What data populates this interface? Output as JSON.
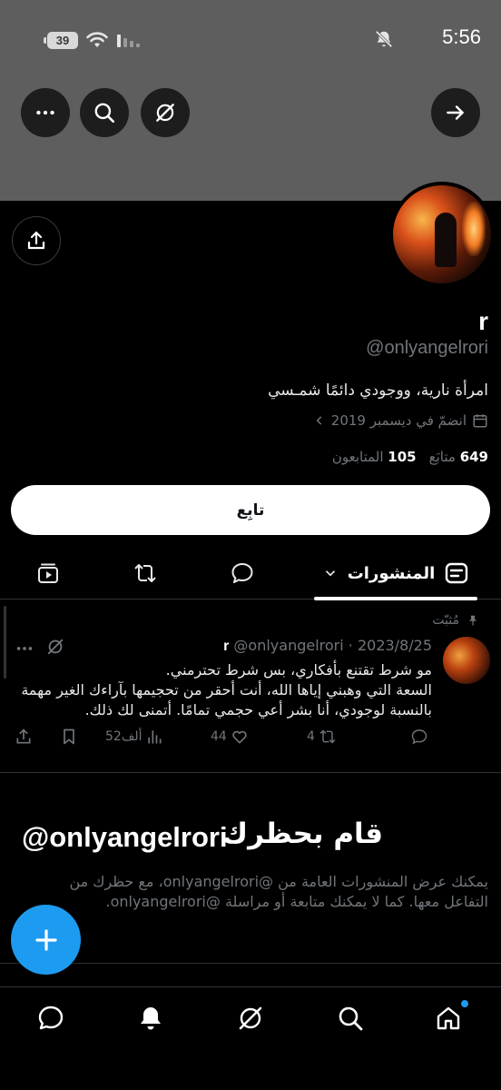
{
  "status_bar": {
    "time": "5:56",
    "battery": "39"
  },
  "header": {
    "more_icon": "more-horizontal-icon",
    "search_icon": "search-icon",
    "grok_icon": "grok-icon",
    "forward_icon": "arrow-forward-icon"
  },
  "profile": {
    "display_name": "r",
    "handle": "@onlyangelrori",
    "bio": "امرأة نارية، ووجودي دائمًا شمـسي",
    "joined": "انضمّ في ديسمبر 2019",
    "following_count": "649",
    "following_label": "متابَع",
    "followers_count": "105",
    "followers_label": "المتابعون",
    "follow_button": "تابِع"
  },
  "tabs": {
    "posts_label": "المنشورات"
  },
  "post": {
    "pinned_label": "مُثبّت",
    "author": "r",
    "handle_date": "@onlyangelrori · 2023/8/25",
    "text": "مو شرط تقتنع بأفكاري، بس شرط تحترمني.\nالسعة التي وهبني إياها الله، أنت أحقر من تحجيمها بآراءك الغير مهمة بالنسبة لوجودي، أنا بشر أعي حجمي تمامًا. أتمنى لك ذلك.",
    "likes": "44",
    "reposts": "4",
    "views": "52ألف"
  },
  "blocked": {
    "title": "قام بحظرك",
    "handle": "@onlyangelrori",
    "description": "يمكنك عرض المنشورات العامة من @onlyangelrori، مع حظرك من التفاعل معها. كما لا يمكنك متابعة أو مراسلة @onlyangelrori."
  },
  "colors": {
    "accent": "#1d9bf0",
    "banner": "#5e5e5e",
    "muted": "#71767b"
  }
}
